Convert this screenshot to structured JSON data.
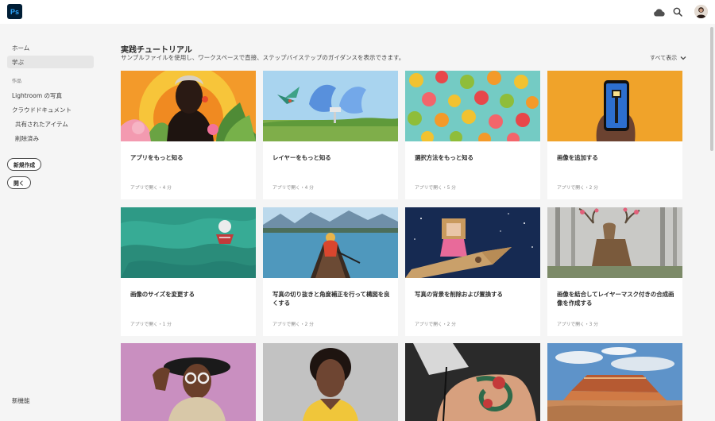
{
  "app": {
    "logo_text": "Ps"
  },
  "sidebar": {
    "items": [
      {
        "label": "ホーム",
        "active": false
      },
      {
        "label": "学ぶ",
        "active": true
      }
    ],
    "section_label": "作品",
    "work_items": [
      {
        "label": "Lightroom の写真"
      },
      {
        "label": "クラウドドキュメント"
      },
      {
        "label": "共有されたアイテム"
      },
      {
        "label": "削除済み"
      }
    ],
    "new_button": "新規作成",
    "open_button": "開く",
    "whats_new": "新機能"
  },
  "main": {
    "title": "実践チュートリアル",
    "subtitle": "サンプルファイルを使用し、ワークスペースで直接、ステップバイステップのガイダンスを表示できます。",
    "see_all": "すべて表示",
    "cards": [
      {
        "title": "アプリをもっと知る",
        "meta": "アプリで開く・4 分"
      },
      {
        "title": "レイヤーをもっと知る",
        "meta": "アプリで開く・4 分"
      },
      {
        "title": "選択方法をもっと知る",
        "meta": "アプリで開く・5 分"
      },
      {
        "title": "画像を追加する",
        "meta": "アプリで開く・2 分"
      },
      {
        "title": "画像のサイズを変更する",
        "meta": "アプリで開く・1 分"
      },
      {
        "title": "写真の切り抜きと角度補正を行って構図を良くする",
        "meta": "アプリで開く・2 分"
      },
      {
        "title": "写真の背景を削除および置換する",
        "meta": "アプリで開く・2 分"
      },
      {
        "title": "画像を結合してレイヤーマスク付きの合成画像を作成する",
        "meta": "アプリで開く・3 分"
      },
      {
        "title": "",
        "meta": ""
      },
      {
        "title": "",
        "meta": ""
      },
      {
        "title": "",
        "meta": ""
      },
      {
        "title": "",
        "meta": ""
      }
    ]
  },
  "colors": {
    "accent": "#31a8ff",
    "logo_bg": "#001e36"
  },
  "icons": [
    "cloud-icon",
    "search-icon",
    "chevron-down-icon"
  ]
}
